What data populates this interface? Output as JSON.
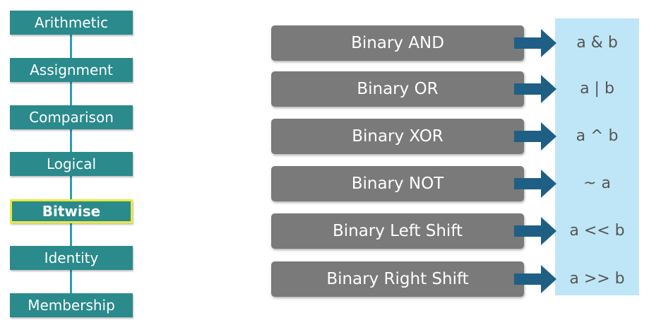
{
  "categories": [
    {
      "label": "Arithmetic",
      "active": false
    },
    {
      "label": "Assignment",
      "active": false
    },
    {
      "label": "Comparison",
      "active": false
    },
    {
      "label": "Logical",
      "active": false
    },
    {
      "label": "Bitwise",
      "active": true
    },
    {
      "label": "Identity",
      "active": false
    },
    {
      "label": "Membership",
      "active": false
    }
  ],
  "operators": [
    {
      "name": "Binary AND",
      "symbol": "a & b"
    },
    {
      "name": "Binary OR",
      "symbol": "a | b"
    },
    {
      "name": "Binary XOR",
      "symbol": "a ^ b"
    },
    {
      "name": "Binary NOT",
      "symbol": "~ a"
    },
    {
      "name": "Binary Left Shift",
      "symbol": "a << b"
    },
    {
      "name": "Binary Right Shift",
      "symbol": "a >> b"
    }
  ],
  "colors": {
    "category_fill": "#2a8a8c",
    "active_border": "#e8ea3a",
    "operator_fill": "#7a7a7a",
    "arrow_fill": "#1f5f86",
    "symbol_panel": "#bfe6f6"
  },
  "icons": {
    "arrow": "right-arrow-icon"
  }
}
